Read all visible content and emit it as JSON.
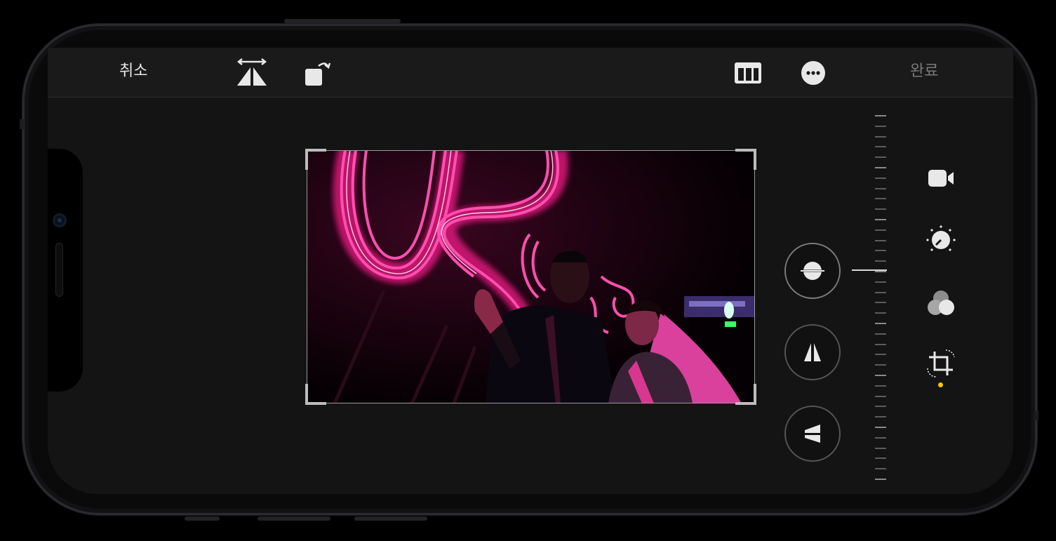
{
  "toolbar": {
    "cancel_label": "취소",
    "done_label": "완료"
  },
  "photo": {
    "neon_color": "#ff1f8e"
  },
  "straighten": {
    "selected": "straighten"
  },
  "colors": {
    "accent_dot": "#ffc400",
    "done_text": "#7a7a7a"
  }
}
